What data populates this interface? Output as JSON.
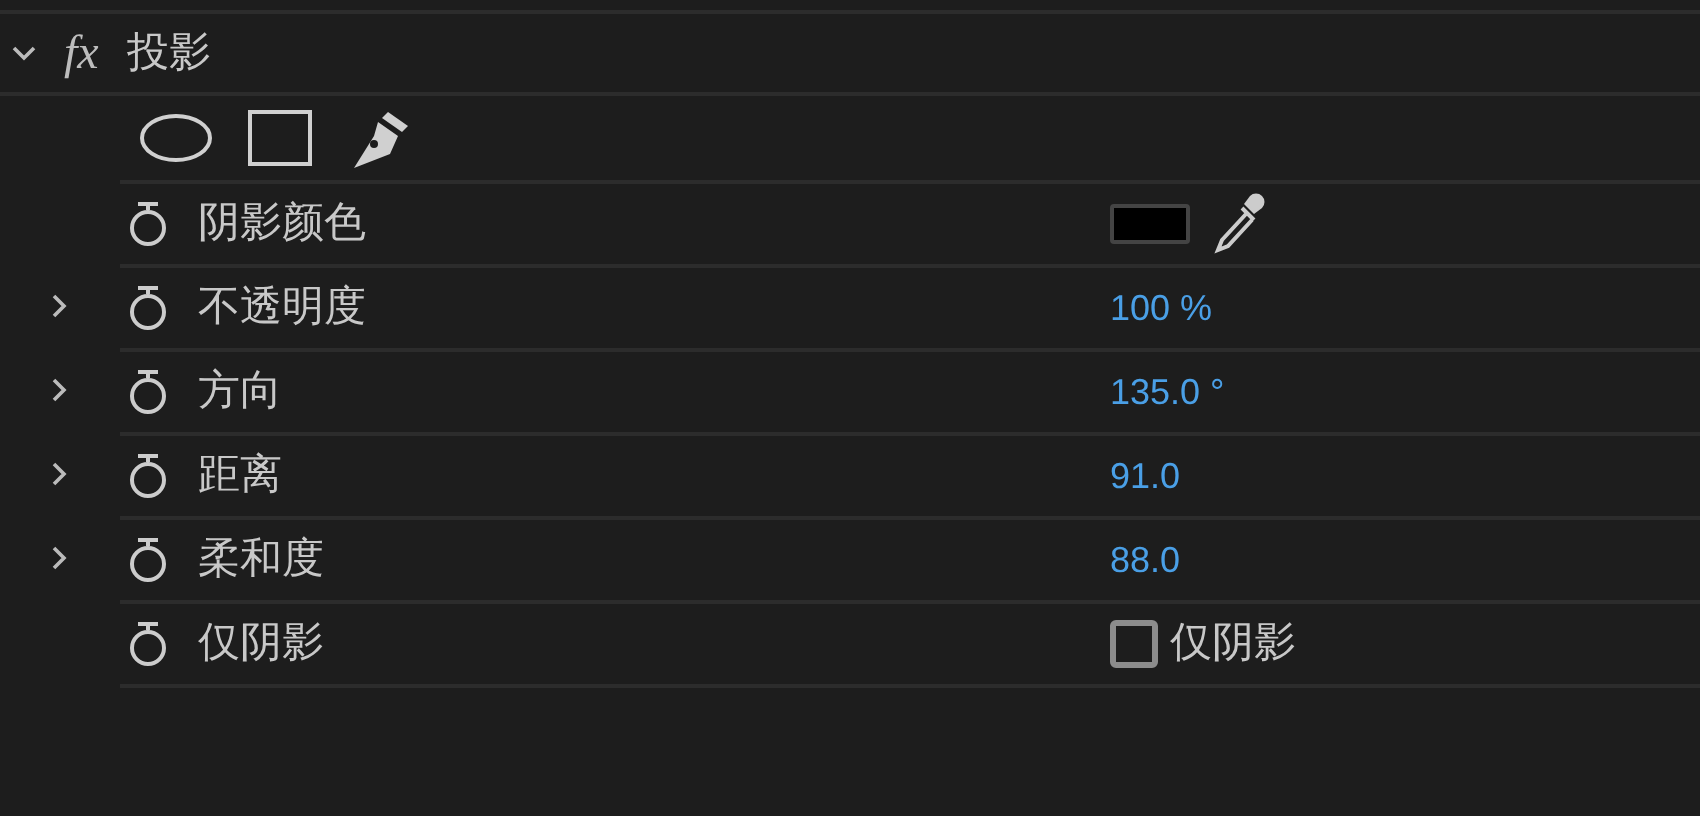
{
  "effect": {
    "icon_text": "fx",
    "name": "投影",
    "expanded": true
  },
  "properties": [
    {
      "kind": "color",
      "label": "阴影颜色",
      "color": "#000000"
    },
    {
      "kind": "number",
      "label": "不透明度",
      "expanded": false,
      "value": "100 %"
    },
    {
      "kind": "number",
      "label": "方向",
      "expanded": false,
      "value": "135.0 °"
    },
    {
      "kind": "number",
      "label": "距离",
      "expanded": false,
      "value": "91.0"
    },
    {
      "kind": "number",
      "label": "柔和度",
      "expanded": false,
      "value": "88.0"
    },
    {
      "kind": "checkbox",
      "label": "仅阴影",
      "checked": false,
      "text": "仅阴影"
    }
  ]
}
